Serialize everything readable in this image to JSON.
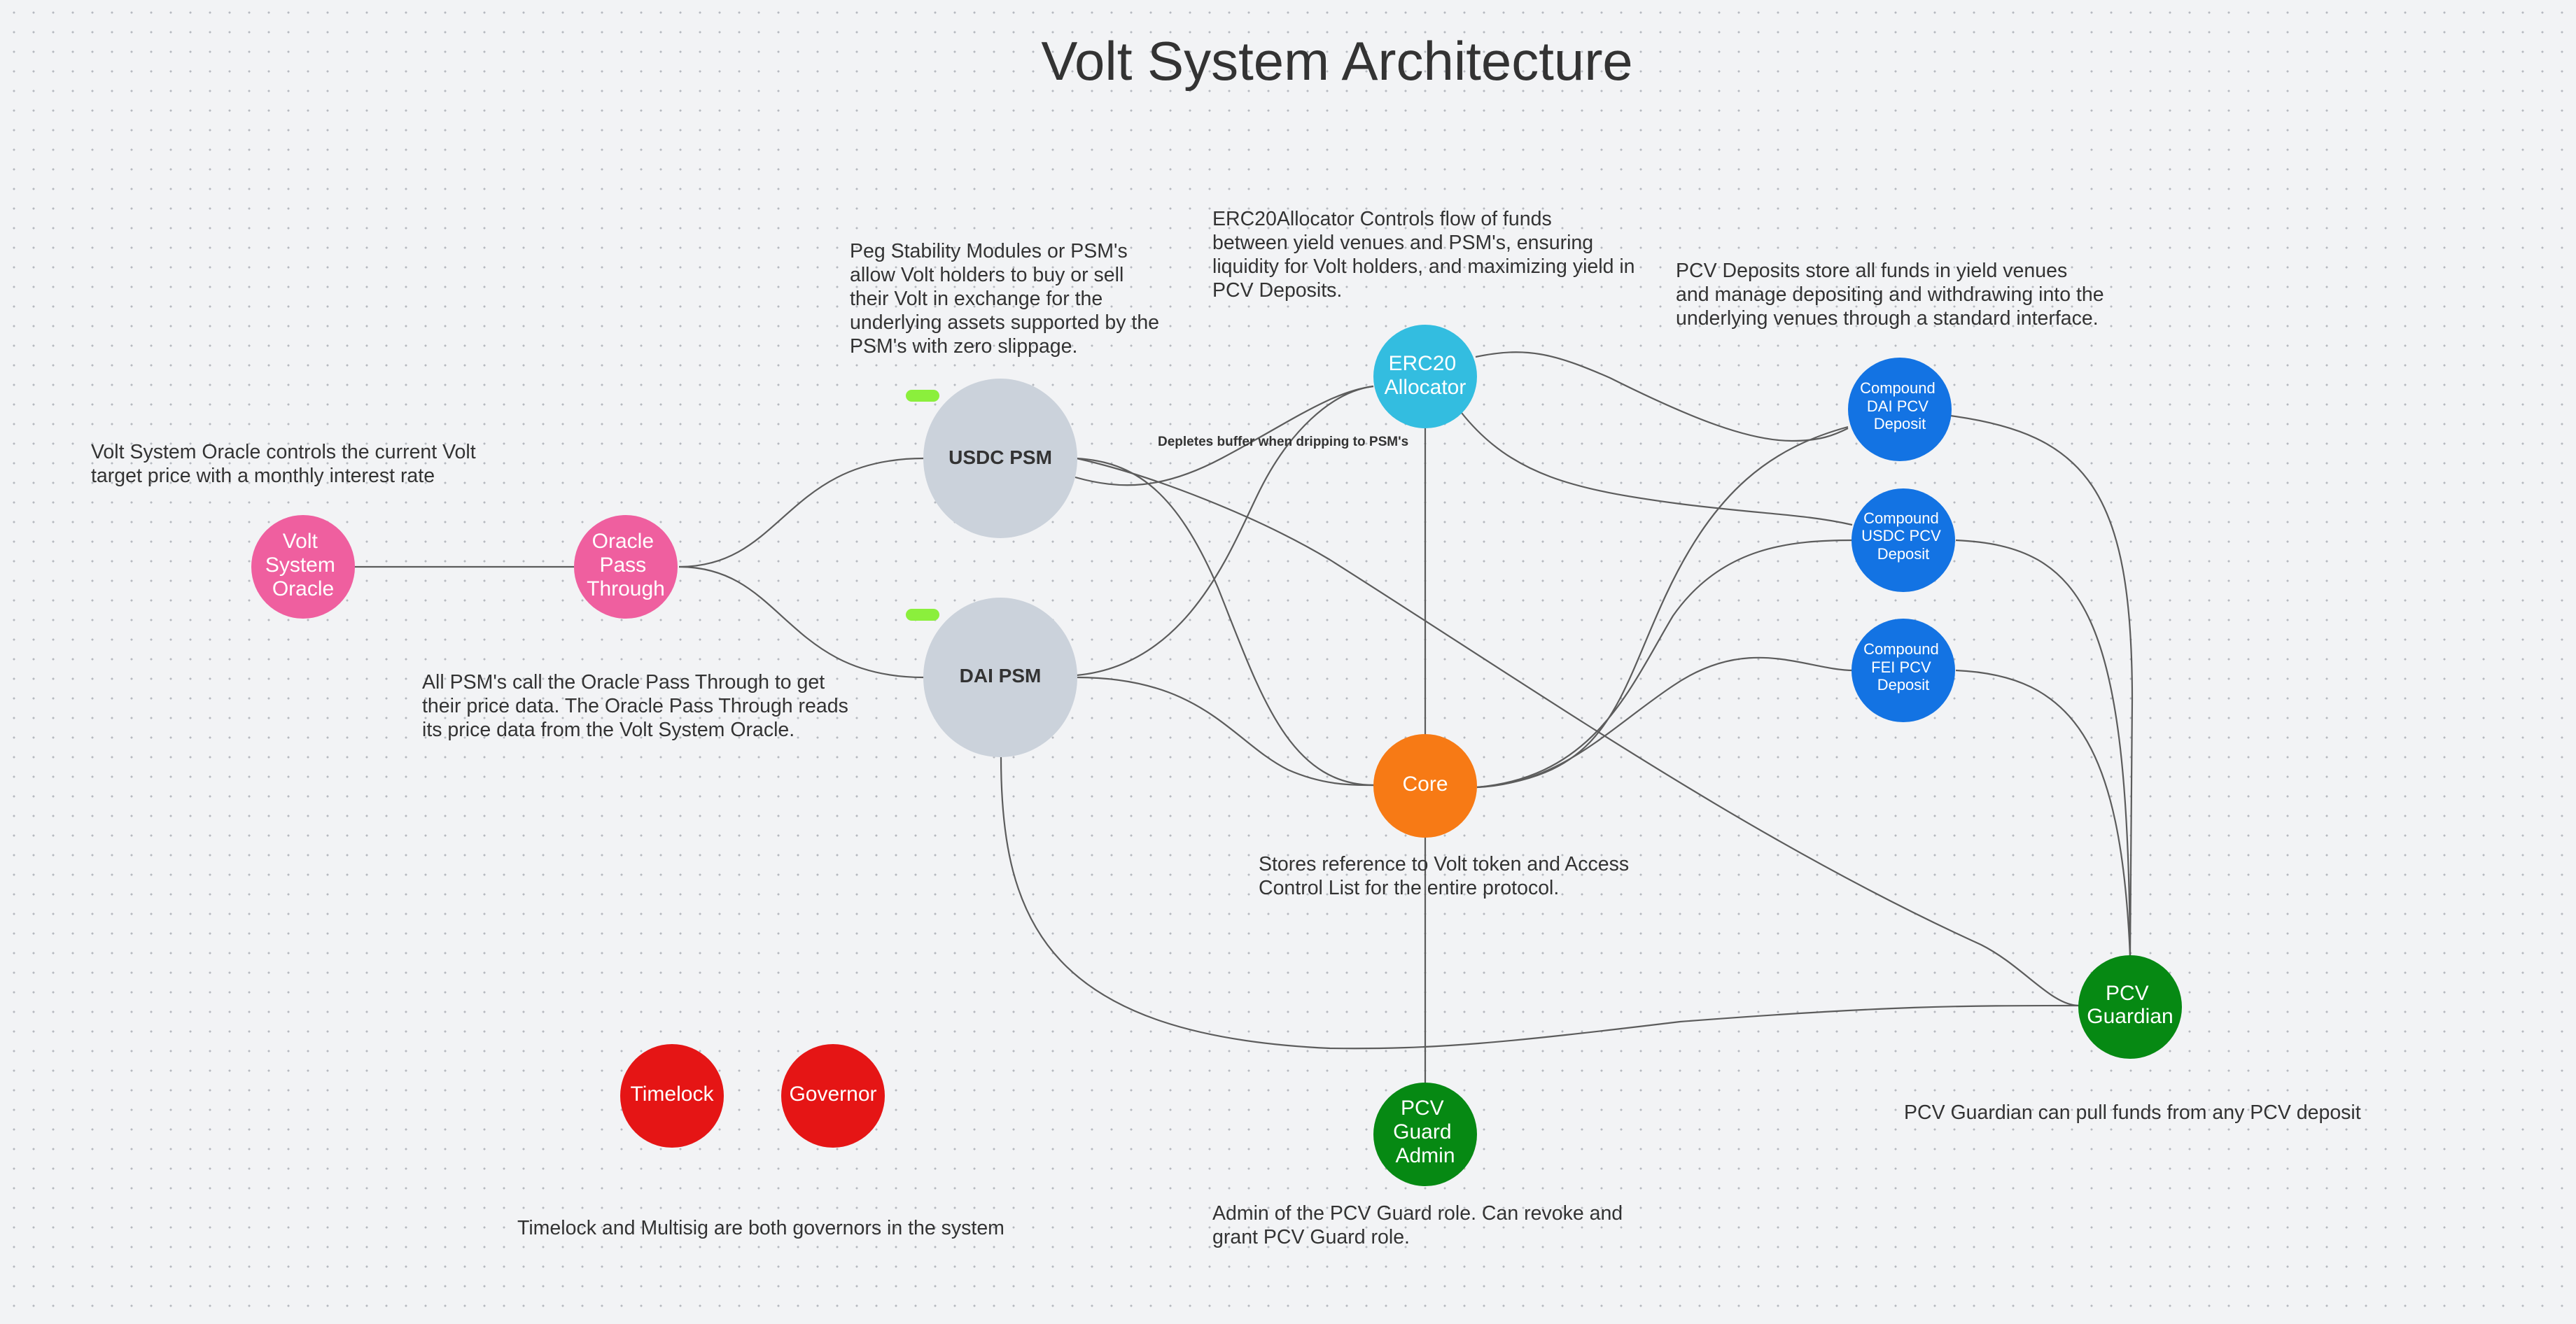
{
  "title": "Volt System Architecture",
  "colors": {
    "oracle": "#ef5f9f",
    "psm": "#cbd2db",
    "allocator": "#33bde0",
    "pcv_deposit": "#1373e3",
    "core": "#f77a15",
    "guard": "#068913",
    "governance": "#e51515",
    "status_pill": "#8bef3c",
    "edge": "#5c5c5c",
    "text": "#333333"
  },
  "nodes": {
    "volt_system_oracle": {
      "lines": [
        "Volt",
        "System",
        "Oracle"
      ]
    },
    "oracle_pass_through": {
      "lines": [
        "Oracle",
        "Pass",
        "Through"
      ]
    },
    "usdc_psm": {
      "lines": [
        "USDC PSM"
      ]
    },
    "dai_psm": {
      "lines": [
        "DAI PSM"
      ]
    },
    "erc20_allocator": {
      "lines": [
        "ERC20",
        "Allocator"
      ]
    },
    "compound_dai_pcv_deposit": {
      "lines": [
        "Compound",
        "DAI PCV",
        "Deposit"
      ]
    },
    "compound_usdc_pcv_deposit": {
      "lines": [
        "Compound",
        "USDC PCV",
        "Deposit"
      ]
    },
    "compound_fei_pcv_deposit": {
      "lines": [
        "Compound",
        "FEI PCV",
        "Deposit"
      ]
    },
    "core": {
      "lines": [
        "Core"
      ]
    },
    "pcv_guardian": {
      "lines": [
        "PCV",
        "Guardian"
      ]
    },
    "pcv_guard_admin": {
      "lines": [
        "PCV",
        "Guard",
        "Admin"
      ]
    },
    "timelock": {
      "lines": [
        "Timelock"
      ]
    },
    "governor": {
      "lines": [
        "Governor"
      ]
    }
  },
  "edge_labels": {
    "allocator_to_psms": "Depletes buffer when dripping to PSM's"
  },
  "notes": {
    "volt_system_oracle": "   Volt System Oracle controls the current Volt\ntarget price with a monthly interest rate",
    "psm": "   Peg Stability Modules or PSM's\nallow Volt holders to buy or sell\ntheir Volt in exchange for the\nunderlying assets supported by the\nPSM's with zero slippage.",
    "erc20_allocator": "   ERC20Allocator Controls flow of funds\nbetween yield venues and PSM's, ensuring\nliquidity for Volt holders, and maximizing yield in\nPCV Deposits.",
    "pcv_deposits": "   PCV Deposits store all funds in yield venues\nand manage depositing and withdrawing into the\nunderlying venues through a standard interface.",
    "oracle_pass_through": "   All PSM's call the Oracle Pass Through to get\ntheir price data. The Oracle Pass Through reads\nits price data from the Volt System Oracle.",
    "core": "   Stores reference to Volt token and Access\nControl List for the entire protocol.",
    "pcv_guardian": "PCV Guardian can pull funds from any PCV deposit",
    "pcv_guard_admin": "   Admin of the PCV Guard role. Can revoke and\ngrant PCV Guard role.",
    "governance": "Timelock and Multisig are both governors in the system"
  },
  "edges": [
    {
      "from": "volt_system_oracle",
      "to": "oracle_pass_through"
    },
    {
      "from": "oracle_pass_through",
      "to": "usdc_psm"
    },
    {
      "from": "oracle_pass_through",
      "to": "dai_psm"
    },
    {
      "from": "usdc_psm",
      "to": "erc20_allocator",
      "label": "allocator_to_psms"
    },
    {
      "from": "dai_psm",
      "to": "erc20_allocator",
      "label": "allocator_to_psms"
    },
    {
      "from": "usdc_psm",
      "to": "core"
    },
    {
      "from": "usdc_psm",
      "to": "pcv_guardian"
    },
    {
      "from": "dai_psm",
      "to": "core"
    },
    {
      "from": "dai_psm",
      "to": "pcv_guardian"
    },
    {
      "from": "erc20_allocator",
      "to": "compound_dai_pcv_deposit"
    },
    {
      "from": "erc20_allocator",
      "to": "compound_usdc_pcv_deposit"
    },
    {
      "from": "erc20_allocator",
      "to": "core"
    },
    {
      "from": "core",
      "to": "compound_dai_pcv_deposit"
    },
    {
      "from": "core",
      "to": "compound_usdc_pcv_deposit"
    },
    {
      "from": "core",
      "to": "compound_fei_pcv_deposit"
    },
    {
      "from": "core",
      "to": "pcv_guard_admin"
    },
    {
      "from": "compound_dai_pcv_deposit",
      "to": "pcv_guardian"
    },
    {
      "from": "compound_usdc_pcv_deposit",
      "to": "pcv_guardian"
    },
    {
      "from": "compound_fei_pcv_deposit",
      "to": "pcv_guardian"
    }
  ]
}
